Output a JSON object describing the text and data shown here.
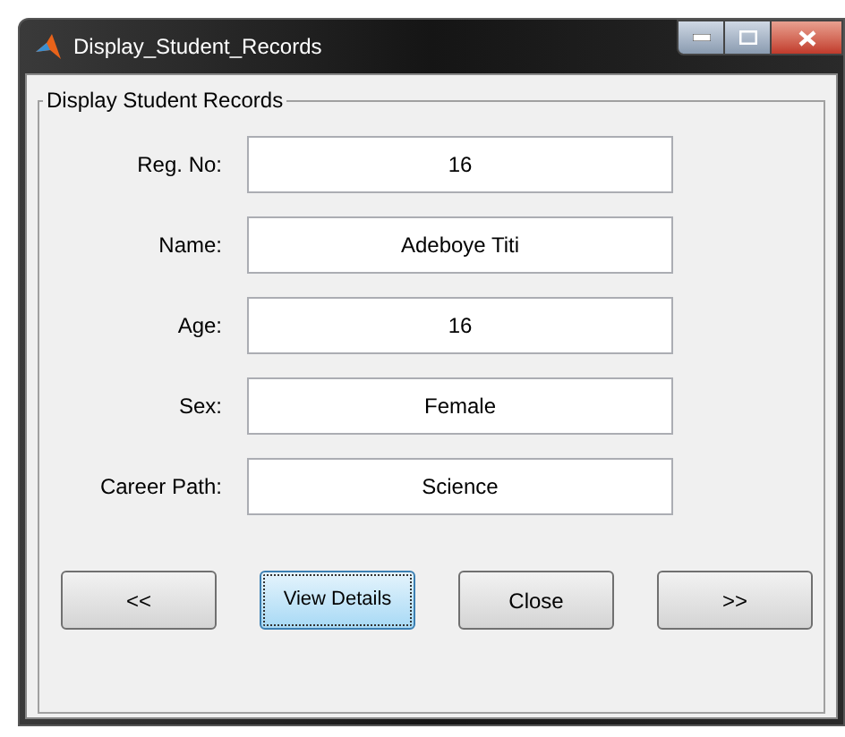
{
  "window": {
    "title": "Display_Student_Records"
  },
  "group": {
    "title": "Display Student Records"
  },
  "fields": [
    {
      "label": "Reg. No:",
      "value": "16"
    },
    {
      "label": "Name:",
      "value": "Adeboye Titi"
    },
    {
      "label": "Age:",
      "value": "16"
    },
    {
      "label": "Sex:",
      "value": "Female"
    },
    {
      "label": "Career Path:",
      "value": "Science"
    }
  ],
  "buttons": [
    {
      "label": "<<",
      "focused": false
    },
    {
      "label": "View Details",
      "focused": true
    },
    {
      "label": "Close",
      "focused": false
    },
    {
      "label": ">>",
      "focused": false
    }
  ]
}
